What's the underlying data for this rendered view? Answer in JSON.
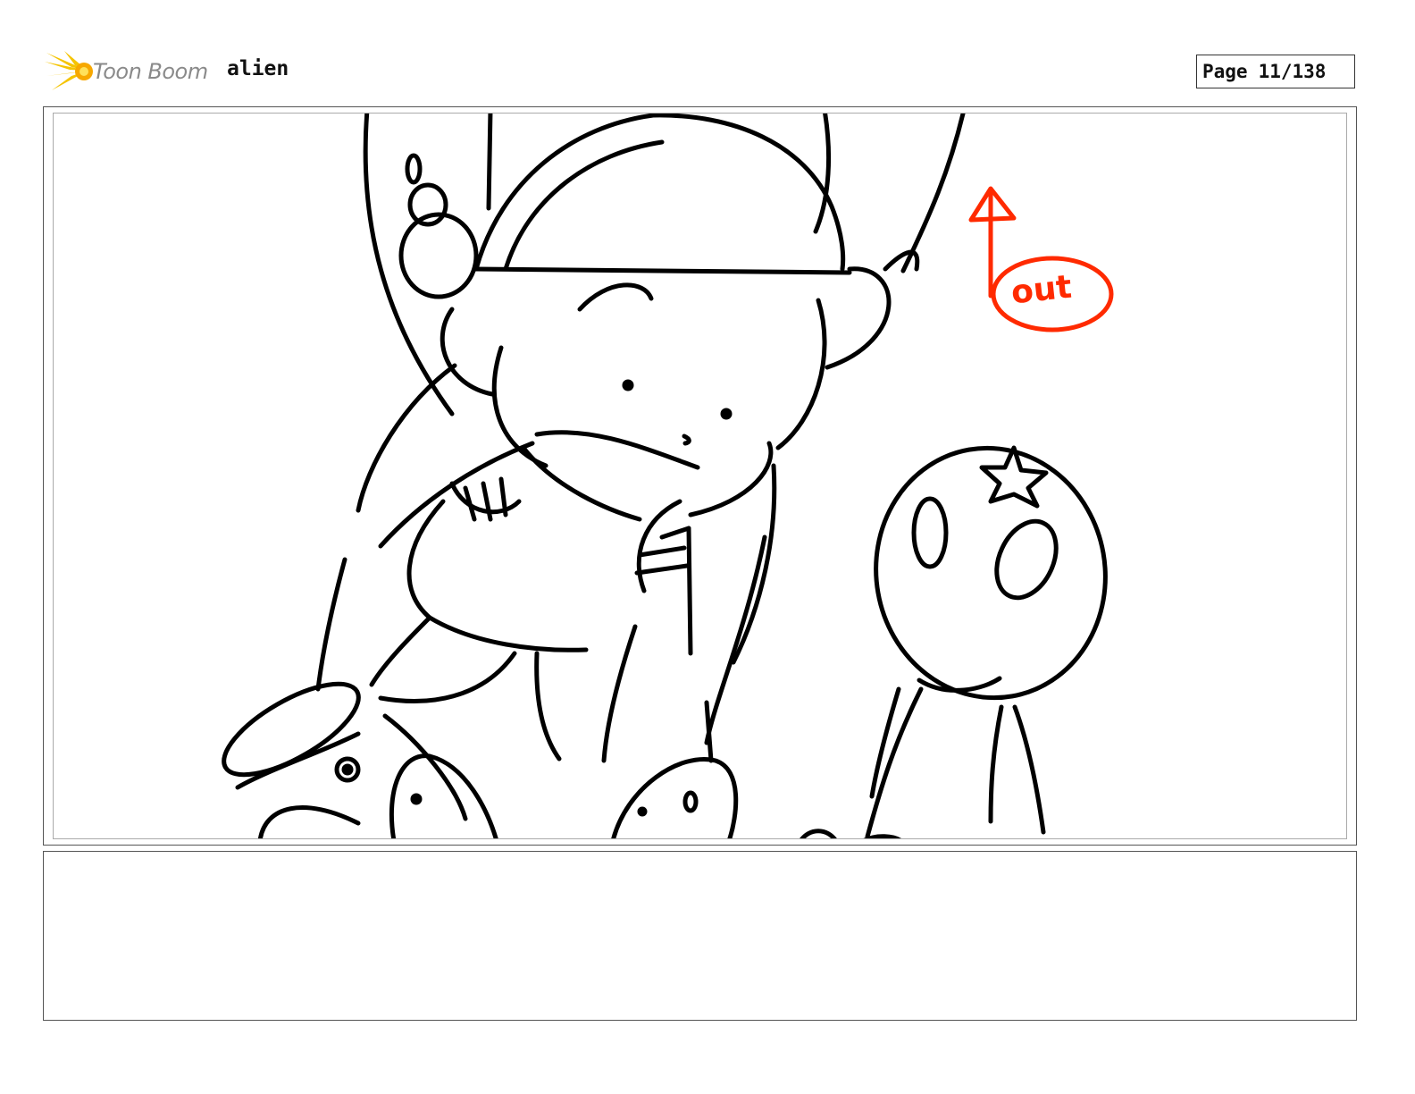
{
  "header": {
    "logo_text": "Toon Boom",
    "logo_icon": "toon-boom-star-icon",
    "project_title": "alien",
    "page_label": "Page",
    "page_number": "11/138"
  },
  "panel": {
    "annotation_text": "out",
    "annotation_color": "#ff2a00",
    "line_color": "#000000"
  },
  "notes": {
    "text": ""
  }
}
